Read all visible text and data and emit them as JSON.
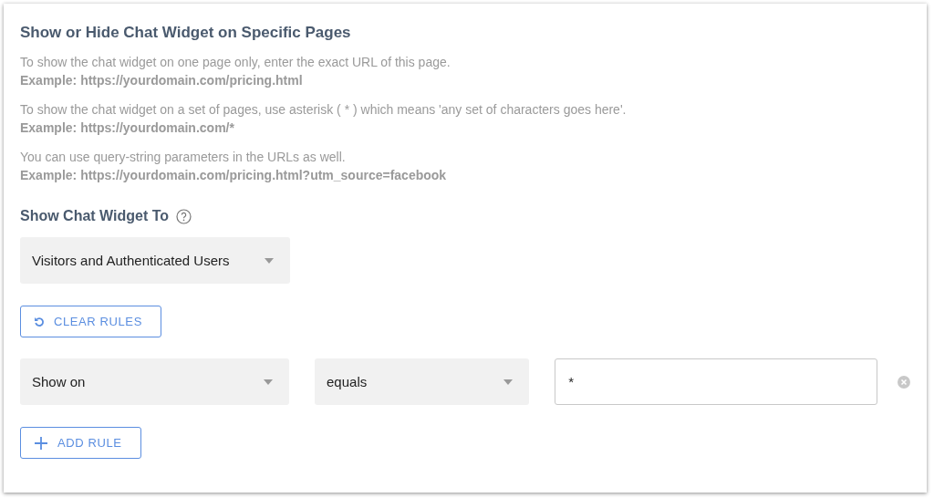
{
  "title": "Show or Hide Chat Widget on Specific Pages",
  "instructions": [
    {
      "text": "To show the chat widget on one page only, enter the exact URL of this page.",
      "example": "Example: https://yourdomain.com/pricing.html"
    },
    {
      "text": "To show the chat widget on a set of pages, use asterisk ( * ) which means 'any set of characters goes here'.",
      "example": "Example: https://yourdomain.com/*"
    },
    {
      "text": "You can use query-string parameters in the URLs as well.",
      "example": "Example: https://yourdomain.com/pricing.html?utm_source=facebook"
    }
  ],
  "audience": {
    "label": "Show Chat Widget To",
    "value": "Visitors and Authenticated Users"
  },
  "clear_button": "CLEAR RULES",
  "rules": [
    {
      "condition": "Show on",
      "operator": "equals",
      "value": "*"
    }
  ],
  "add_button": "ADD RULE"
}
